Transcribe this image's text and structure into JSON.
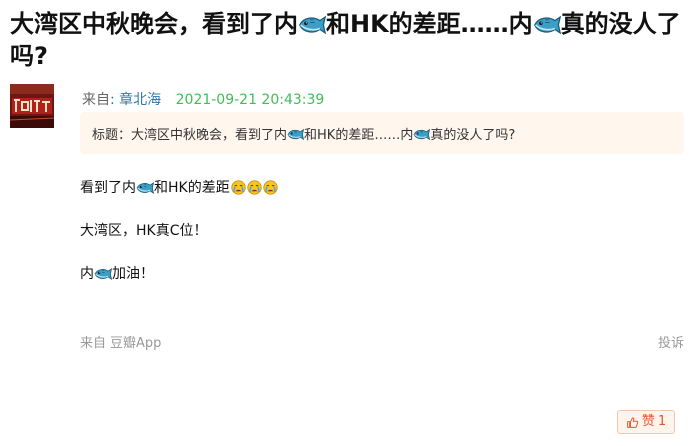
{
  "post": {
    "title_part1": "大湾区中秋晚会，看到了内",
    "title_part2": "和HK的差距……内",
    "title_part3": "真的没人了吗?",
    "meta": {
      "from_label": "来自:",
      "author": "章北海",
      "timestamp": "2021-09-21 20:43:39"
    },
    "quote": {
      "label": "标题：",
      "part1": "大湾区中秋晚会，看到了内",
      "part2": "和HK的差距……内",
      "part3": "真的没人了吗?"
    },
    "body": {
      "line1_a": "看到了内",
      "line1_b": "和HK的差距",
      "line2": "大湾区，HK真C位！",
      "line3_a": "内",
      "line3_b": "加油！"
    },
    "footer": {
      "source_label": "来自",
      "source_app": "豆瓣App",
      "report": "投诉"
    },
    "like": {
      "label": "赞",
      "count": "1"
    }
  },
  "icons": {
    "fish": "fish-emoji-icon",
    "cry": "crying-face-icon",
    "thumb": "thumbs-up-icon"
  },
  "colors": {
    "author_link": "#3377aa",
    "timestamp": "#42bd56",
    "quote_bg": "#fff6ee",
    "like_accent": "#e4572e"
  }
}
